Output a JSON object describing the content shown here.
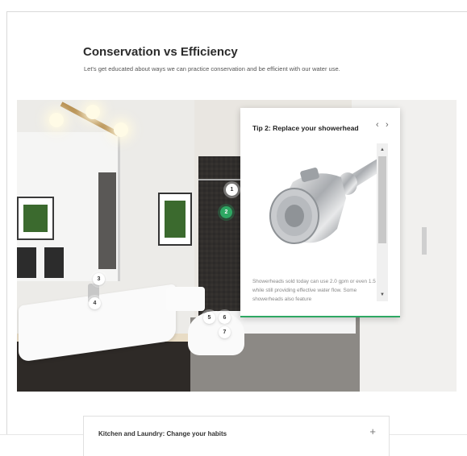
{
  "header": {
    "title": "Conservation vs Efficiency",
    "subtitle": "Let's get educated about ways we can practice conservation and be efficient with our water use."
  },
  "scene": {
    "hotspots": [
      {
        "label": "1",
        "active": false
      },
      {
        "label": "2",
        "active": true
      },
      {
        "label": "3",
        "active": false
      },
      {
        "label": "4",
        "active": false
      },
      {
        "label": "5",
        "active": false
      },
      {
        "label": "6",
        "active": false
      },
      {
        "label": "7",
        "active": false
      }
    ]
  },
  "tip": {
    "title": "Tip 2: Replace your showerhead",
    "prev_icon": "‹",
    "next_icon": "›",
    "body": "Showerheads sold today can use 2.0 gpm or even 1.5 gpm while still providing effective water flow. Some showerheads also feature",
    "image_icon": "showerhead-image",
    "scroll_up_icon": "▲",
    "scroll_down_icon": "▼"
  },
  "accordion": {
    "label": "Kitchen and Laundry: Change your habits",
    "icon": "+"
  },
  "colors": {
    "accent": "#2ea863"
  }
}
